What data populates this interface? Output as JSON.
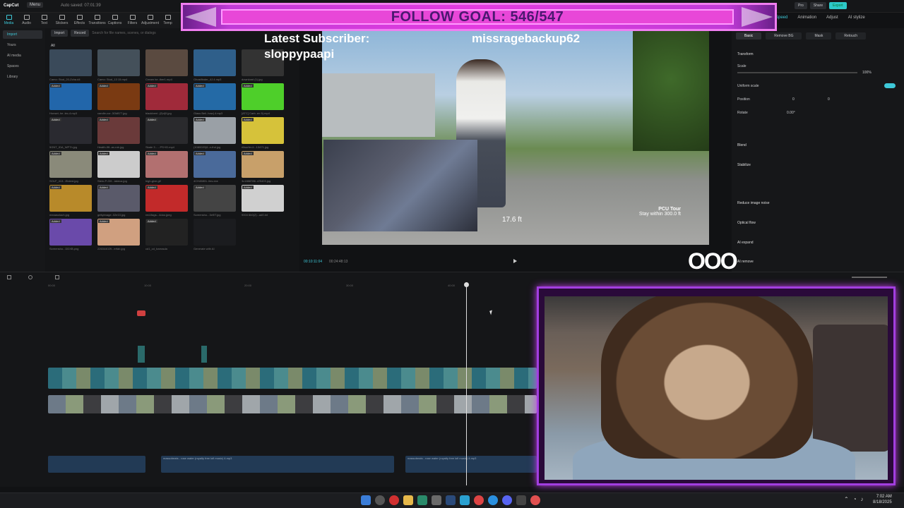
{
  "app": {
    "name": "CapCut",
    "menu_label": "Menu",
    "autosave": "Auto saved: 07:01:39"
  },
  "tool_tabs": [
    "Media",
    "Audio",
    "Text",
    "Stickers",
    "Effects",
    "Transitions",
    "Captions",
    "Filters",
    "Adjustment",
    "Temp"
  ],
  "left_nav": [
    "Import",
    "Yours",
    "AI media",
    "Spaces",
    "Library"
  ],
  "media_bar": {
    "import": "Import",
    "record": "Record",
    "search_placeholder": "Search for file names, scenes, or dialogs",
    "filter": "All"
  },
  "media_items": [
    {
      "cap": "Camo: Stud_20-Zcha.d4",
      "added": "",
      "color": "#3a4a5a"
    },
    {
      "cap": "Camo: Stud_13 15.mp4",
      "added": "",
      "color": "#44505a"
    },
    {
      "cap": "Cream he..ther1.mp4",
      "added": "",
      "color": "#5a4a40"
    },
    {
      "cap": "Ghostfinder_4J.4.mp3",
      "added": "",
      "color": "#2f5f8a"
    },
    {
      "cap": "download (1).jpg",
      "added": "",
      "color": "#333"
    },
    {
      "cap": "Honset..he..lec-4.mp3",
      "added": "Added",
      "color": "#2266aa"
    },
    {
      "cap": "candle-cor..3OkB77.jpg",
      "added": "Added",
      "color": "#7a3a12"
    },
    {
      "cap": "blackberri..(2)d(0.jpg",
      "added": "Added",
      "color": "#a02a3a"
    },
    {
      "cap": "Glass Beli..how(.4.mp3",
      "added": "Added",
      "color": "#246aa6"
    },
    {
      "cap": "[ATC] Carb..en 5).mp4",
      "added": "Added",
      "color": "#4ecf2a"
    },
    {
      "cap": "5GNT_IDA_WP7h.jpg",
      "added": "Added",
      "color": "#2a2a30"
    },
    {
      "cap": "Health-9ft..ax-rob.jpg",
      "added": "Added",
      "color": "#6a3a3a"
    },
    {
      "cap": "Skate 3 - ...PS+ID.mp4",
      "added": "Added",
      "color": "#2a2a2d"
    },
    {
      "cap": "(1080020)6..n-thd.jpg",
      "added": "Added",
      "color": "#9aa0a6"
    },
    {
      "cap": "rilisurfer-il...13471.jpg",
      "added": "Added",
      "color": "#d6c23a"
    },
    {
      "cap": "SOLF_413...Elderd.jpg",
      "added": "Added",
      "color": "#8a8a7a"
    },
    {
      "cap": "Stein-P-GH...lakeca.jpg",
      "added": "Added",
      "color": "#ccc"
    },
    {
      "cap": "high-give.gif",
      "added": "Added",
      "color": "#b27070"
    },
    {
      "cap": "4CH45801..lles.exe",
      "added": "Added",
      "color": "#4a6a9a"
    },
    {
      "cap": "3c1888786..rZ5403.jpg",
      "added": "Added",
      "color": "#c8a06a"
    },
    {
      "cap": "meaasolach.jpg",
      "added": "Added",
      "color": "#b88a2a"
    },
    {
      "cap": "gettyimage..02e10.jpg",
      "added": "Added",
      "color": "#5a5a6a"
    },
    {
      "cap": "red-flags-..4doo.jpeg",
      "added": "Added",
      "color": "#c22a2a"
    },
    {
      "cap": "Screensho...3xf0T.jpg",
      "added": "Added",
      "color": "#444"
    },
    {
      "cap": "9004 6b0(2)...ad0.int",
      "added": "Added",
      "color": "#d0d0d0"
    },
    {
      "cap": "Screensho...DDXB.png",
      "added": "Added",
      "color": "#6a4aaa"
    },
    {
      "cap": "226344029...erfab.jpg",
      "added": "Added",
      "color": "#d0a080"
    },
    {
      "cap": "cd1_cd_barrasda",
      "added": "Added",
      "color": "#222"
    },
    {
      "cap": "Generate with AI",
      "added": "",
      "color": "#1b1c1f"
    }
  ],
  "preview": {
    "timecode": "00:10:11:04",
    "duration": "00:24:48:13",
    "pcu_title": "PCU Tour",
    "pcu_sub": "Stay within 300.0 ft",
    "distance": "17.6 ft"
  },
  "top_right": {
    "pro": "Pro",
    "share": "Share",
    "export": "Export"
  },
  "right_tabs": [
    "Speed",
    "Animation",
    "Adjust",
    "AI stylize"
  ],
  "prop_tabs": [
    "Basic",
    "Remove BG",
    "Mask",
    "Retouch"
  ],
  "props": {
    "transform": "Transform",
    "scale": "Scale",
    "scale_value": "100%",
    "uniform": "Uniform scale",
    "position": "Position",
    "pos_x": "0",
    "pos_y": "0",
    "rotate": "Rotate",
    "rotate_value": "0.00°",
    "blend": "Blend",
    "stabilize": "Stabilize",
    "reduce_noise": "Reduce image noise",
    "optical_flow": "Optical flow",
    "ai_expand": "AI expand",
    "ai_remove": "AI remove"
  },
  "timeline": {
    "ruler": [
      "00:00",
      "10:00",
      "20:00",
      "30:00",
      "40:00"
    ],
    "audio1": "massobeats - rose water (royalty free lofi music) 4.mp3",
    "audio2": "massobeats - rose water (royalty free lofi music) 4.mp3",
    "clip_labels": "2025-08-18 0..."
  },
  "stream_overlay": {
    "follow_goal": "FOLLOW GOAL: 546/547",
    "latest_subscriber_label": "Latest Subscriber:",
    "latest_subscriber_name": "sloppypaapi",
    "streamer": "missragebackup62",
    "ooo": "OOO"
  },
  "taskbar": {
    "time": "7:02 AM",
    "date": "8/18/2025"
  },
  "colors": {
    "accent": "#3ec8d8",
    "overlay_pink": "#e847d8",
    "overlay_purple": "#a23ee0"
  }
}
